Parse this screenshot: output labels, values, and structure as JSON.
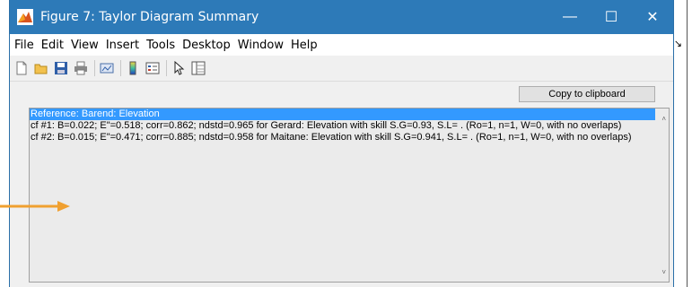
{
  "window": {
    "title": "Figure 7: Taylor Diagram Summary",
    "controls": {
      "minimize": "—",
      "maximize": "☐",
      "close": "✕"
    }
  },
  "menu": {
    "items": [
      "File",
      "Edit",
      "View",
      "Insert",
      "Tools",
      "Desktop",
      "Window",
      "Help"
    ],
    "dock_arrow": "↘"
  },
  "toolbar": {
    "icons": [
      "new-figure-icon",
      "open-file-icon",
      "save-icon",
      "print-icon",
      "link-plot-icon",
      "colorbar-icon",
      "legend-icon",
      "edit-plot-arrow-icon",
      "property-inspector-icon"
    ]
  },
  "copy_button": {
    "label": "Copy to clipboard"
  },
  "list": {
    "rows": [
      "Reference: Barend: Elevation",
      "cf #1: B=0.022; E\"=0.518; corr=0.862; ndstd=0.965 for Gerard: Elevation with skill S.G=0.93, S.L= . (Ro=1, n=1, W=0, with no overlaps)",
      "cf #2: B=0.015; E\"=0.471; corr=0.885; ndstd=0.958 for Maitane: Elevation with skill S.G=0.941, S.L= . (Ro=1, n=1, W=0, with no overlaps)"
    ],
    "selected_index": 0,
    "scroll_up": "˄",
    "scroll_down": "˅"
  },
  "colors": {
    "titlebar": "#2d7ab8",
    "selection": "#3399ff",
    "annotation_arrow": "#f0a030"
  }
}
